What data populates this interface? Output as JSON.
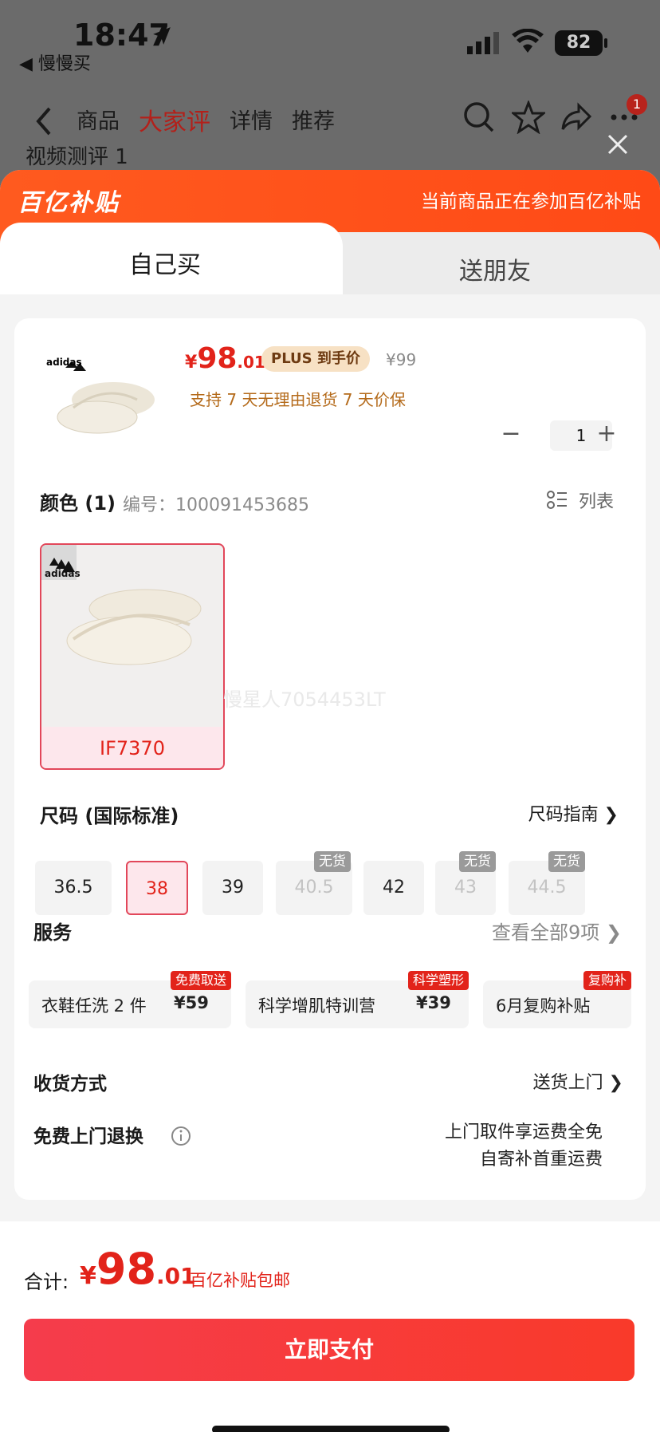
{
  "status_bar": {
    "time": "18:47",
    "back_app": "◀ 慢慢买",
    "battery": "82"
  },
  "nav": {
    "tabs": [
      "商品",
      "大家评",
      "详情",
      "推荐"
    ],
    "active_index": 1,
    "badge": "1",
    "bg_text": "视频测评 1"
  },
  "banner": {
    "logo": "百亿补贴",
    "note": "当前商品正在参加百亿补贴"
  },
  "tabs": {
    "self": "自己买",
    "gift": "送朋友"
  },
  "product": {
    "brand": "adidas",
    "price_currency": "¥",
    "price_int": "98",
    "price_dec": ".01",
    "plus_badge": "PLUS 到手价",
    "orig_price": "¥99",
    "services": "支持 7 天无理由退货   7 天价保",
    "quantity": "1",
    "minus": "−",
    "plus": "+"
  },
  "color": {
    "title": "颜色 (1)",
    "code": "编号：100091453685",
    "list_label": "列表",
    "swatch_label": "IF7370",
    "watermark": "慢星人7054453LT"
  },
  "size": {
    "title": "尺码 (国际标准)",
    "guide": "尺码指南 ❯",
    "options": [
      "36.5",
      "38",
      "39",
      "40.5",
      "42",
      "43",
      "44.5"
    ],
    "selected": "38",
    "out_of_stock_label": "无货"
  },
  "services": {
    "title": "服务",
    "view_all": "查看全部9项",
    "items": [
      {
        "name": "衣鞋任洗 2 件",
        "price": "¥59",
        "tag": "免费取送"
      },
      {
        "name": "科学增肌特训营",
        "price": "¥39",
        "tag": "科学塑形"
      },
      {
        "name": "6月复购补贴",
        "price": "",
        "tag": "复购补"
      }
    ]
  },
  "delivery": {
    "label": "收货方式",
    "value": "送货上门 ❯"
  },
  "returns": {
    "label": "免费上门退换",
    "line1": "上门取件享运费全免",
    "line2": "自寄补首重运费"
  },
  "total": {
    "label": "合计:",
    "currency": "¥",
    "int": "98",
    "dec": ".01",
    "note": "百亿补贴包邮"
  },
  "pay_button": "立即支付",
  "colors": {
    "accent": "#e2231a",
    "banner": "#ff5a1f",
    "pay": "#f53c4c"
  }
}
